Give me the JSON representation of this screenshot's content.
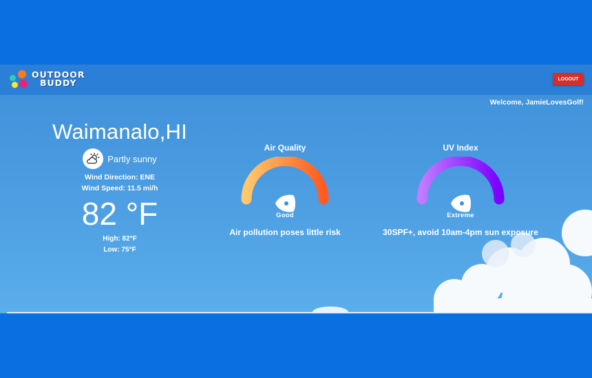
{
  "app": {
    "logo_line1": "OUTDOOR",
    "logo_line2": "BUDDY",
    "logout_label": "LOGOUT",
    "welcome_text": "Welcome, JamieLovesGolf!"
  },
  "weather": {
    "city": "Waimanalo,HI",
    "condition": "Partly sunny",
    "condition_icon": "partly-sunny-icon",
    "wind_direction": "Wind Direction: ENE",
    "wind_speed": "Wind Speed: 11.5 mi/h",
    "temperature": "82 °F",
    "high": "High: 82°F",
    "low": "Low: 75°F"
  },
  "air_quality": {
    "title": "Air Quality",
    "level": "Good",
    "message": "Air pollution poses little risk",
    "colors": [
      "#ffc96b",
      "#ff5a1f"
    ]
  },
  "uv_index": {
    "title": "UV Index",
    "level": "Extreme",
    "message": "30SPF+, avoid 10am-4pm sun exposure",
    "colors": [
      "#c07bff",
      "#7a00ff"
    ]
  }
}
